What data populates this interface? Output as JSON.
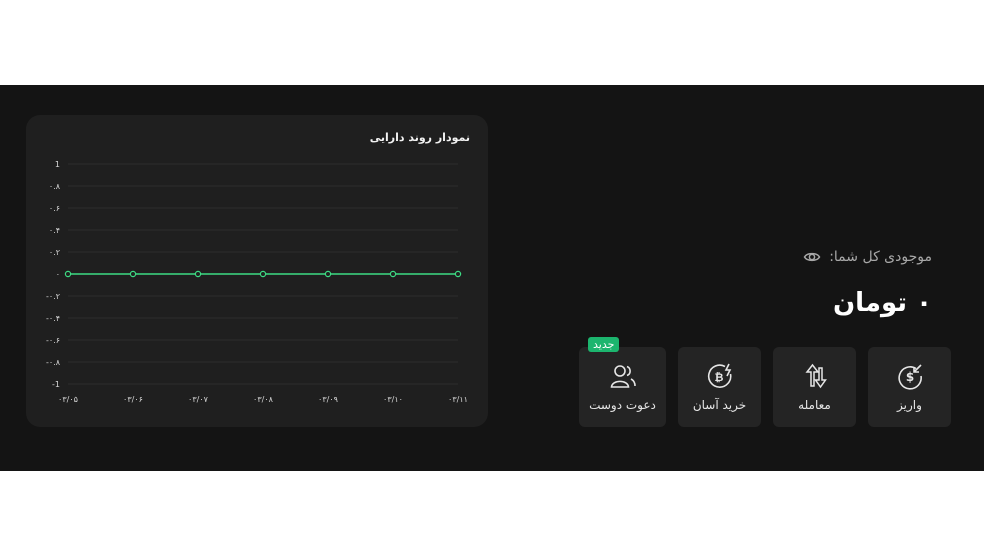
{
  "chart": {
    "title": "نمودار روند دارایی"
  },
  "chart_data": {
    "type": "line",
    "title": "نمودار روند دارایی",
    "x": [
      "۰۳/۰۵",
      "۰۳/۰۶",
      "۰۳/۰۷",
      "۰۳/۰۸",
      "۰۳/۰۹",
      "۰۳/۱۰",
      "۰۳/۱۱"
    ],
    "series": [
      {
        "values": [
          0,
          0,
          0,
          0,
          0,
          0,
          0
        ]
      }
    ],
    "ylim": [
      -1,
      1
    ],
    "y_ticks": [
      1,
      0.8,
      0.6,
      0.4,
      0.2,
      0,
      -0.2,
      -0.4,
      -0.6,
      -0.8,
      -1
    ],
    "y_tick_labels": [
      "1",
      "۰.۸",
      "۰.۶",
      "۰.۴",
      "۰.۲",
      "۰",
      "-۰.۲",
      "-۰.۴",
      "-۰.۶",
      "-۰.۸",
      "-1"
    ],
    "grid": true,
    "line_color": "#3ddc84"
  },
  "balance": {
    "label": "موجودی کل شما:",
    "value": "۰ تومان",
    "eye_icon": "eye-icon"
  },
  "actions": [
    {
      "label": "واریز",
      "icon": "deposit-icon"
    },
    {
      "label": "معامله",
      "icon": "trade-icon"
    },
    {
      "label": "خرید آسان",
      "icon": "bitcoin-buy-icon"
    },
    {
      "label": "دعوت دوست",
      "icon": "invite-friends-icon",
      "badge": "جدید"
    }
  ],
  "colors": {
    "background": "#141414",
    "card": "#1f1f1f",
    "button": "#242424",
    "accent_green": "#1cb56e"
  }
}
